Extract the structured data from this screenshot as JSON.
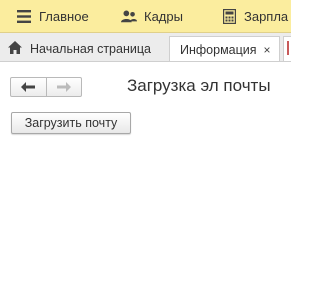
{
  "menu": {
    "items": [
      {
        "label": "Главное",
        "icon": "menu-lines-icon"
      },
      {
        "label": "Кадры",
        "icon": "people-icon"
      },
      {
        "label": "Зарпла",
        "icon": "calculator-icon"
      }
    ]
  },
  "tabs": {
    "home_label": "Начальная страница",
    "info_label": "Информация",
    "info_close": "×"
  },
  "form": {
    "title": "Загрузка эл почты",
    "load_button_label": "Загрузить почту"
  },
  "colors": {
    "menu_bg": "#fbed9e",
    "tabs_bg": "#ececec"
  }
}
